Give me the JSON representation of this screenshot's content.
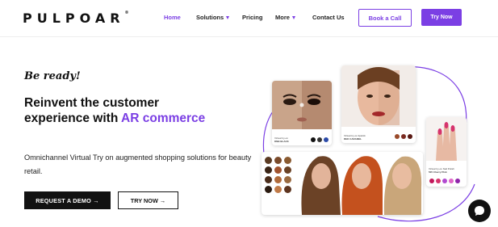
{
  "brand": {
    "logo": "PULPOAR",
    "accent": "#7b3fe4"
  },
  "nav": {
    "home": "Home",
    "solutions": "Solutions",
    "pricing": "Pricing",
    "more": "More",
    "contact": "Contact Us",
    "book_call": "Book a Call",
    "try_now": "Try Now"
  },
  "hero": {
    "tagline": "Be ready!",
    "headline_line1": "Reinvent the customer",
    "headline_line2": "experience with",
    "headline_accent": "AR commerce",
    "subtext": "Omnichannel Virtual Try on augmented shopping solutions for beauty retail.",
    "demo_button": "REQUEST A DEMO",
    "try_button": "TRY NOW",
    "arrow": "→"
  },
  "cards": {
    "eyes": {
      "product": "DNB BLACK"
    },
    "lips": {
      "product": "RED CARAMEL"
    },
    "nails": {
      "product": "505 Cherry Pink"
    }
  },
  "icons": {
    "caret": "chevron-down-icon",
    "arrow": "arrow-right-icon",
    "chat": "chat-icon"
  }
}
